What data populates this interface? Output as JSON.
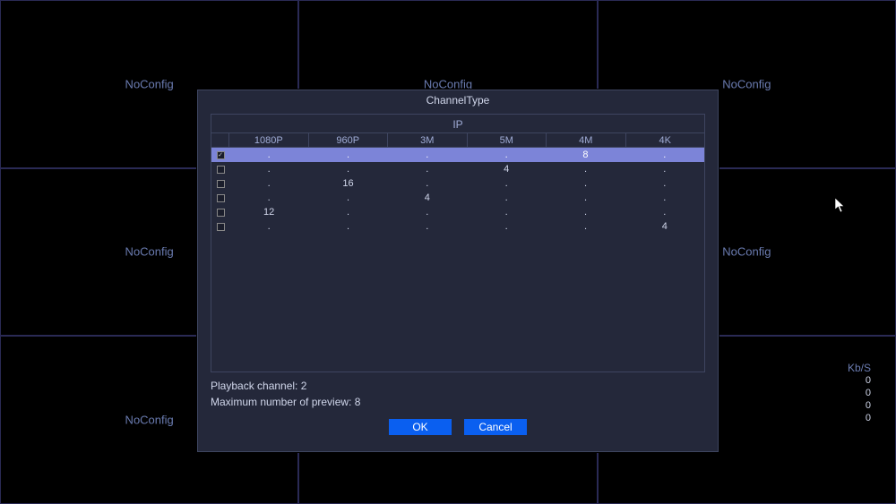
{
  "background_label": "NoConfig",
  "stats": {
    "title": "Kb/S",
    "values": [
      "0",
      "0",
      "0",
      "0"
    ]
  },
  "dialog": {
    "title": "ChannelType",
    "ip_label": "IP",
    "columns": [
      "1080P",
      "960P",
      "3M",
      "5M",
      "4M",
      "4K"
    ],
    "rows": [
      {
        "checked": true,
        "cells": [
          ".",
          ".",
          ".",
          ".",
          "8",
          "."
        ]
      },
      {
        "checked": false,
        "cells": [
          ".",
          ".",
          ".",
          "4",
          ".",
          "."
        ]
      },
      {
        "checked": false,
        "cells": [
          ".",
          "16",
          ".",
          ".",
          ".",
          "."
        ]
      },
      {
        "checked": false,
        "cells": [
          ".",
          ".",
          "4",
          ".",
          ".",
          "."
        ]
      },
      {
        "checked": false,
        "cells": [
          "12",
          ".",
          ".",
          ".",
          ".",
          "."
        ]
      },
      {
        "checked": false,
        "cells": [
          ".",
          ".",
          ".",
          ".",
          ".",
          "4"
        ]
      }
    ],
    "playback_text": "Playback channel: 2",
    "preview_text": "Maximum number of preview: 8",
    "ok_label": "OK",
    "cancel_label": "Cancel"
  }
}
